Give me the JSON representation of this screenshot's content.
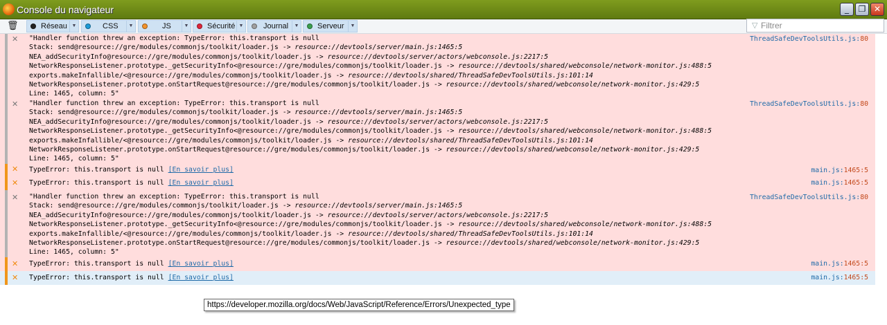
{
  "window": {
    "title": "Console du navigateur",
    "buttons": {
      "minimize": "_",
      "maximize": "❐",
      "close": "✕"
    }
  },
  "toolbar": {
    "trash_icon": "trash-icon",
    "filters": [
      {
        "label": "Réseau",
        "dot": "#222222"
      },
      {
        "label": "CSS",
        "dot": "#1e9bd7"
      },
      {
        "label": "JS",
        "dot": "#f3932b"
      },
      {
        "label": "Sécurité",
        "dot": "#e0263b"
      },
      {
        "label": "Journal",
        "dot": "#a0a0a0"
      },
      {
        "label": "Serveur",
        "dot": "#3ba04f"
      }
    ],
    "filter_placeholder": "Filtrer"
  },
  "messages": [
    {
      "type": "exception",
      "lines": [
        "\"Handler function threw an exception: TypeError: this.transport is null",
        "Stack: send@resource://gre/modules/commonjs/toolkit/loader.js -> resource://devtools/server/main.js:1465:5",
        "NEA_addSecurityInfo@resource://gre/modules/commonjs/toolkit/loader.js -> resource://devtools/server/actors/webconsole.js:2217:5",
        "NetworkResponseListener.prototype._getSecurityInfo<@resource://gre/modules/commonjs/toolkit/loader.js -> resource://devtools/shared/webconsole/network-monitor.js:488:5",
        "exports.makeInfallible/<@resource://gre/modules/commonjs/toolkit/loader.js -> resource://devtools/shared/ThreadSafeDevToolsUtils.js:101:14",
        "NetworkResponseListener.prototype.onStartRequest@resource://gre/modules/commonjs/toolkit/loader.js -> resource://devtools/shared/webconsole/network-monitor.js:429:5",
        "Line: 1465, column: 5\""
      ],
      "source": "ThreadSafeDevToolsUtils.js",
      "line": "80"
    },
    {
      "type": "exception",
      "lines": [
        "\"Handler function threw an exception: TypeError: this.transport is null",
        "Stack: send@resource://gre/modules/commonjs/toolkit/loader.js -> resource://devtools/server/main.js:1465:5",
        "NEA_addSecurityInfo@resource://gre/modules/commonjs/toolkit/loader.js -> resource://devtools/server/actors/webconsole.js:2217:5",
        "NetworkResponseListener.prototype._getSecurityInfo<@resource://gre/modules/commonjs/toolkit/loader.js -> resource://devtools/shared/webconsole/network-monitor.js:488:5",
        "exports.makeInfallible/<@resource://gre/modules/commonjs/toolkit/loader.js -> resource://devtools/shared/ThreadSafeDevToolsUtils.js:101:14",
        "NetworkResponseListener.prototype.onStartRequest@resource://gre/modules/commonjs/toolkit/loader.js -> resource://devtools/shared/webconsole/network-monitor.js:429:5",
        "Line: 1465, column: 5\""
      ],
      "source": "ThreadSafeDevToolsUtils.js",
      "line": "80"
    },
    {
      "type": "jserror",
      "text": "TypeError: this.transport is null",
      "link": "[En savoir plus]",
      "source": "main.js",
      "line": "1465:5"
    },
    {
      "type": "jserror",
      "text": "TypeError: this.transport is null",
      "link": "[En savoir plus]",
      "source": "main.js",
      "line": "1465:5"
    },
    {
      "type": "exception",
      "lines": [
        "\"Handler function threw an exception: TypeError: this.transport is null",
        "Stack: send@resource://gre/modules/commonjs/toolkit/loader.js -> resource://devtools/server/main.js:1465:5",
        "NEA_addSecurityInfo@resource://gre/modules/commonjs/toolkit/loader.js -> resource://devtools/server/actors/webconsole.js:2217:5",
        "NetworkResponseListener.prototype._getSecurityInfo<@resource://gre/modules/commonjs/toolkit/loader.js -> resource://devtools/shared/webconsole/network-monitor.js:488:5",
        "exports.makeInfallible/<@resource://gre/modules/commonjs/toolkit/loader.js -> resource://devtools/shared/ThreadSafeDevToolsUtils.js:101:14",
        "NetworkResponseListener.prototype.onStartRequest@resource://gre/modules/commonjs/toolkit/loader.js -> resource://devtools/shared/webconsole/network-monitor.js:429:5",
        "Line: 1465, column: 5\""
      ],
      "source": "ThreadSafeDevToolsUtils.js",
      "line": "80"
    },
    {
      "type": "jserror",
      "text": "TypeError: this.transport is null",
      "link": "[En savoir plus]",
      "source": "main.js",
      "line": "1465:5"
    },
    {
      "type": "jserror",
      "selected": true,
      "text": "TypeError: this.transport is null",
      "link": "[En savoir plus]",
      "source": "main.js",
      "line": "1465:5"
    }
  ],
  "tooltip": "https://developer.mozilla.org/docs/Web/JavaScript/Reference/Errors/Unexpected_type"
}
